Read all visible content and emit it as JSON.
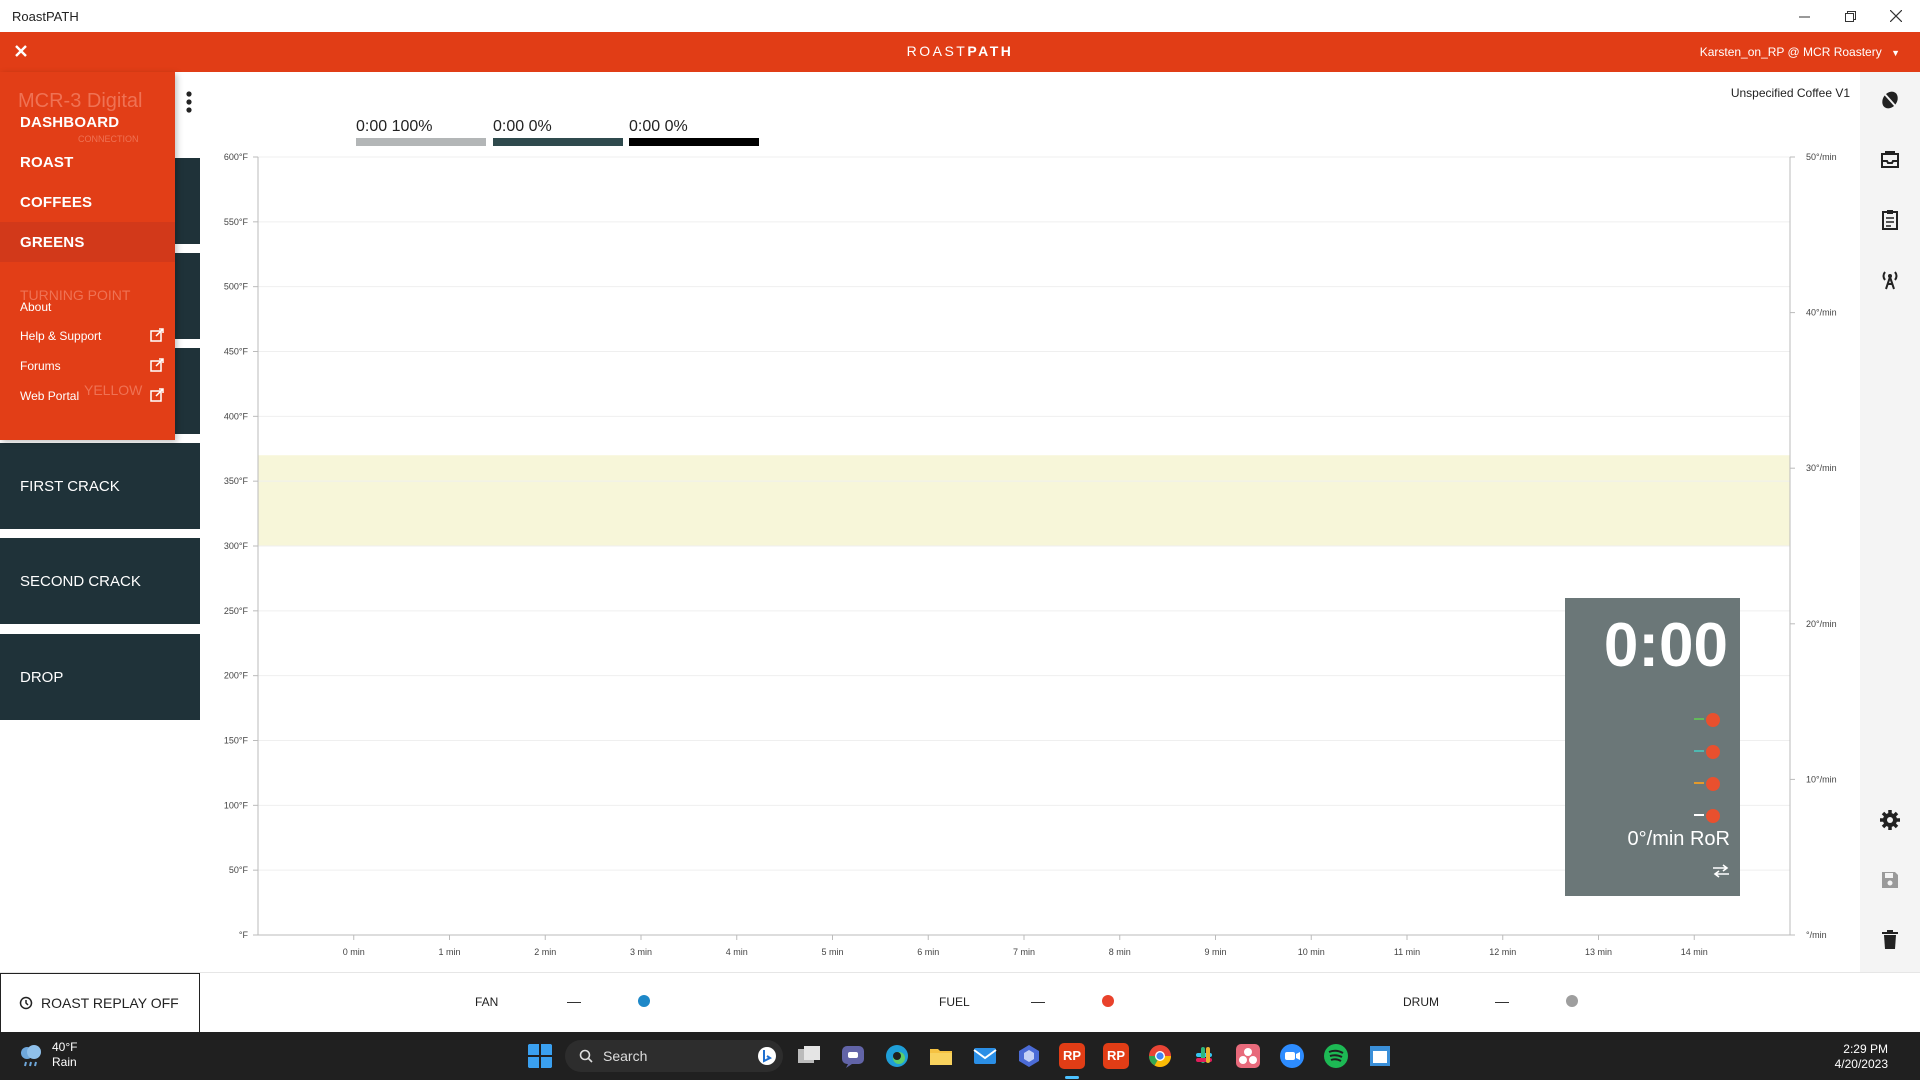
{
  "window": {
    "title": "RoastPATH"
  },
  "header": {
    "logo_light": "ROAST",
    "logo_bold": "PATH",
    "user": "Karsten_on_RP @ MCR Roastery"
  },
  "background_text": {
    "machine": "MCR-3 Digital",
    "connection": "CONNECTION",
    "turning_point": "TURNING POINT",
    "yellow": "YELLOW"
  },
  "drawer": {
    "nav": [
      "DASHBOARD",
      "ROAST",
      "COFFEES",
      "GREENS"
    ],
    "secondary": [
      {
        "label": "About",
        "external": false
      },
      {
        "label": "Help & Support",
        "external": true
      },
      {
        "label": "Forums",
        "external": true
      },
      {
        "label": "Web Portal",
        "external": true
      }
    ]
  },
  "milestones": [
    "FIRST CRACK",
    "SECOND CRACK",
    "DROP"
  ],
  "coffee": {
    "name": "Unspecified Coffee V1"
  },
  "legend": [
    {
      "time": "0:00",
      "pct": "100%",
      "color": "#b3b6b7"
    },
    {
      "time": "0:00",
      "pct": "0%",
      "color": "#2f4a4d"
    },
    {
      "time": "0:00",
      "pct": "0%",
      "color": "#000000"
    }
  ],
  "chart_data": {
    "type": "line",
    "x": {
      "label": "",
      "unit": "min",
      "range": [
        -1,
        15
      ],
      "ticks": [
        0,
        1,
        2,
        3,
        4,
        5,
        6,
        7,
        8,
        9,
        10,
        11,
        12,
        13,
        14
      ]
    },
    "y_left": {
      "unit": "°F",
      "range": [
        0,
        600
      ],
      "ticks": [
        0,
        50,
        100,
        150,
        200,
        250,
        300,
        350,
        400,
        450,
        500,
        550,
        600
      ],
      "tick_labels": [
        "°F",
        "50°F",
        "100°F",
        "150°F",
        "200°F",
        "250°F",
        "300°F",
        "350°F",
        "400°F",
        "450°F",
        "500°F",
        "550°F",
        "600°F"
      ]
    },
    "y_right": {
      "unit": "°/min",
      "range": [
        0,
        50
      ],
      "ticks": [
        0,
        10,
        20,
        30,
        40,
        50
      ],
      "tick_labels": [
        "°/min",
        "10°/min",
        "20°/min",
        "30°/min",
        "40°/min",
        "50°/min"
      ]
    },
    "band": {
      "from": 300,
      "to": 370,
      "color": "#f7f6d9"
    },
    "series": [],
    "grid": true
  },
  "timer": {
    "time": "0:00",
    "ror": "0°/min RoR",
    "rows": [
      {
        "color": "#63b95a"
      },
      {
        "color": "#4fb8b1"
      },
      {
        "color": "#e39a2b"
      },
      {
        "color": "#ffffff"
      }
    ]
  },
  "controls": {
    "replay": "ROAST REPLAY OFF",
    "fan": {
      "label": "FAN",
      "value": "—",
      "color": "#1e88c8"
    },
    "fuel": {
      "label": "FUEL",
      "value": "—",
      "color": "#e9422b"
    },
    "drum": {
      "label": "DRUM",
      "value": "—",
      "color": "#9e9e9e"
    }
  },
  "taskbar": {
    "temp": "40°F",
    "weather": "Rain",
    "search": "Search",
    "time": "2:29 PM",
    "date": "4/20/2023",
    "rp1": "RP",
    "rp2": "RP"
  }
}
